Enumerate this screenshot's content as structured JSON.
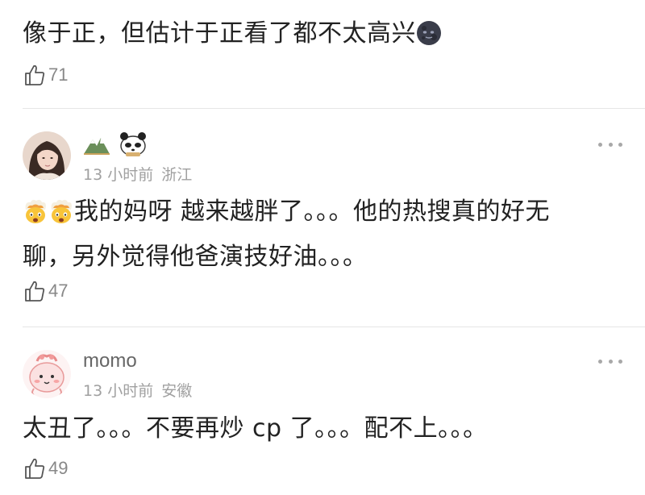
{
  "comments": [
    {
      "text": "像于正，但估计于正看了都不太高兴",
      "emoji_trailing": "new-moon-face",
      "likes": "71"
    },
    {
      "username": "",
      "badges": [
        "mountain-badge",
        "panda-badge"
      ],
      "time": "13 小时前",
      "location": "浙江",
      "emoji_leading": [
        "exploding-head",
        "exploding-head"
      ],
      "text_line1": "我的妈呀 越来越胖了。。。他的热搜真的好无",
      "text_line2": "聊，另外觉得他爸演技好油。。。",
      "likes": "47"
    },
    {
      "username": "momo",
      "time": "13 小时前",
      "location": "安徽",
      "text": "太丑了。。。不要再炒 cp 了。。。配不上。。。",
      "likes": "49"
    }
  ]
}
